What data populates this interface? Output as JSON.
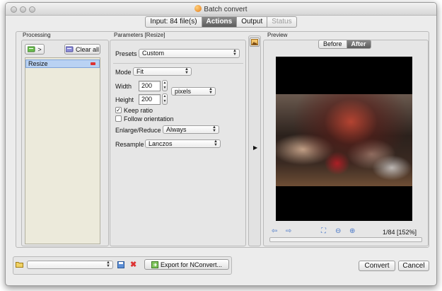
{
  "window": {
    "title": "Batch convert"
  },
  "tabs": [
    {
      "label": "Input: 84 file(s)",
      "state": "normal"
    },
    {
      "label": "Actions",
      "state": "active"
    },
    {
      "label": "Output",
      "state": "normal"
    },
    {
      "label": "Status",
      "state": "disabled"
    }
  ],
  "processing": {
    "title": "Processing",
    "add_label": ">",
    "clear_label": "Clear all",
    "items": [
      {
        "label": "Resize",
        "selected": true
      }
    ]
  },
  "parameters": {
    "title": "Parameters [Resize]",
    "presets_label": "Presets",
    "presets_value": "Custom",
    "mode_label": "Mode",
    "mode_value": "Fit",
    "width_label": "Width",
    "width_value": "200",
    "height_label": "Height",
    "height_value": "200",
    "unit_value": "pixels",
    "keep_ratio_label": "Keep ratio",
    "keep_ratio_checked": true,
    "follow_orientation_label": "Follow orientation",
    "follow_orientation_checked": false,
    "enlarge_label": "Enlarge/Reduce",
    "enlarge_value": "Always",
    "resample_label": "Resample",
    "resample_value": "Lanczos"
  },
  "preview": {
    "title": "Preview",
    "before_label": "Before",
    "after_label": "After",
    "active_view": "After",
    "status": "1/84 [152%]"
  },
  "footer": {
    "dropdown_value": "",
    "export_label": "Export for NConvert...",
    "convert_label": "Convert",
    "cancel_label": "Cancel"
  },
  "colors": {
    "active_tab": "#6e6e6e",
    "selected_row": "#b9d2f3",
    "list_background": "#eceadb",
    "remove_icon": "#dd3333"
  }
}
